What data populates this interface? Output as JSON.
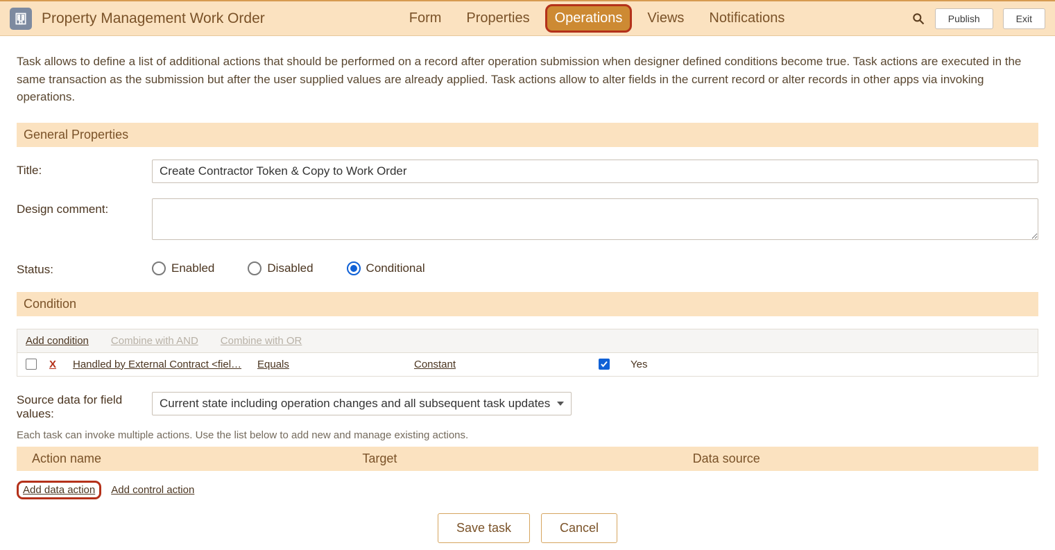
{
  "header": {
    "title": "Property Management Work Order",
    "tabs": [
      "Form",
      "Properties",
      "Operations",
      "Views",
      "Notifications"
    ],
    "active_tab": "Operations",
    "publish": "Publish",
    "exit": "Exit"
  },
  "intro": "Task allows to define a list of additional actions that should be performed on a record after operation submission when designer defined conditions become true. Task actions are executed in the same transaction as the submission but after the user supplied values are already applied. Task actions allow to alter fields in the current record or alter records in other apps via invoking operations.",
  "sections": {
    "general": "General Properties",
    "condition": "Condition"
  },
  "form": {
    "title_label": "Title:",
    "title_value": "Create Contractor Token & Copy to Work Order",
    "design_comment_label": "Design comment:",
    "design_comment_value": "",
    "status_label": "Status:",
    "status_options": {
      "enabled": "Enabled",
      "disabled": "Disabled",
      "conditional": "Conditional"
    },
    "status_selected": "conditional"
  },
  "condition": {
    "toolbar": {
      "add": "Add condition",
      "and": "Combine with AND",
      "or": "Combine with OR"
    },
    "row": {
      "delete": "X",
      "field": "Handled by External Contract <fiel…",
      "operator": "Equals",
      "value_type": "Constant",
      "value": "Yes",
      "checked": true
    }
  },
  "source": {
    "label": "Source data for field values:",
    "value": "Current state including operation changes and all subsequent task updates"
  },
  "actions_hint": "Each task can invoke multiple actions. Use the list below to add new and manage existing actions.",
  "actions_table": {
    "col1": "Action name",
    "col2": "Target",
    "col3": "Data source"
  },
  "add_links": {
    "data": "Add data action",
    "control": "Add control action"
  },
  "footer": {
    "save": "Save task",
    "cancel": "Cancel"
  }
}
